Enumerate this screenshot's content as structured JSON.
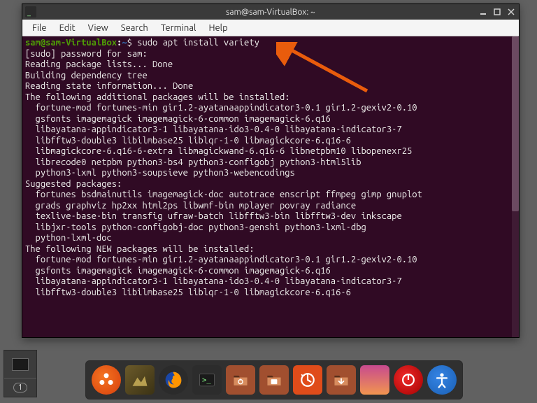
{
  "window": {
    "title": "sam@sam-VirtualBox: ~"
  },
  "menu": {
    "file": "File",
    "edit": "Edit",
    "view": "View",
    "search": "Search",
    "terminal": "Terminal",
    "help": "Help"
  },
  "prompt": {
    "userhost": "sam@sam-VirtualBox",
    "path": "~",
    "symbol": "$"
  },
  "command": "sudo apt install variety",
  "output_lines": [
    "[sudo] password for sam:",
    "Reading package lists... Done",
    "Building dependency tree",
    "Reading state information... Done",
    "The following additional packages will be installed:",
    "  fortune-mod fortunes-min gir1.2-ayatanaappindicator3-0.1 gir1.2-gexiv2-0.10",
    "  gsfonts imagemagick imagemagick-6-common imagemagick-6.q16",
    "  libayatana-appindicator3-1 libayatana-ido3-0.4-0 libayatana-indicator3-7",
    "  libfftw3-double3 libilmbase25 liblqr-1-0 libmagickcore-6.q16-6",
    "  libmagickcore-6.q16-6-extra libmagickwand-6.q16-6 libnetpbm10 libopenexr25",
    "  librecode0 netpbm python3-bs4 python3-configobj python3-html5lib",
    "  python3-lxml python3-soupsieve python3-webencodings",
    "Suggested packages:",
    "  fortunes bsdmainutils imagemagick-doc autotrace enscript ffmpeg gimp gnuplot",
    "  grads graphviz hp2xx html2ps libwmf-bin mplayer povray radiance",
    "  texlive-base-bin transfig ufraw-batch libfftw3-bin libfftw3-dev inkscape",
    "  libjxr-tools python-configobj-doc python3-genshi python3-lxml-dbg",
    "  python-lxml-doc",
    "The following NEW packages will be installed:",
    "  fortune-mod fortunes-min gir1.2-ayatanaappindicator3-0.1 gir1.2-gexiv2-0.10",
    "  gsfonts imagemagick imagemagick-6-common imagemagick-6.q16",
    "  libayatana-appindicator3-1 libayatana-ido3-0.4-0 libayatana-indicator3-7",
    "  libfftw3-double3 libilmbase25 liblqr-1-0 libmagickcore-6.q16-6"
  ],
  "taskswitcher": {
    "workspace": "1"
  },
  "colors": {
    "terminal_bg": "#300a24",
    "prompt_green": "#4e9a06",
    "prompt_blue": "#3465a4",
    "arrow": "#e95c0c"
  }
}
